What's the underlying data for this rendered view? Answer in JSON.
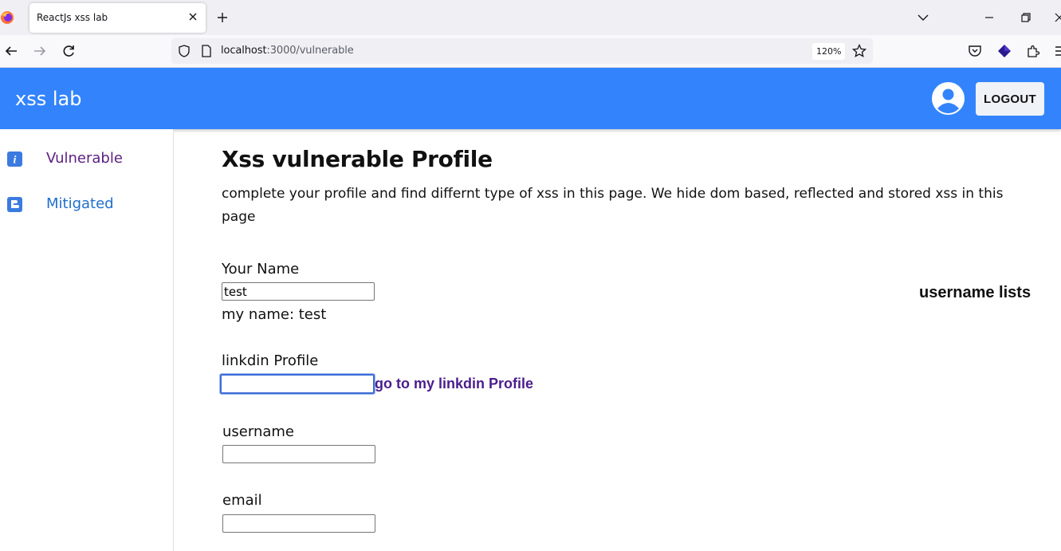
{
  "browser": {
    "tab_title": "ReactJs xss lab",
    "url_host": "localhost",
    "url_rest": ":3000/vulnerable",
    "zoom": "120%"
  },
  "app": {
    "title": "xss lab",
    "logout_label": "LOGOUT"
  },
  "sidebar": {
    "items": [
      {
        "label": "Vulnerable",
        "icon": "info-icon",
        "color": "#5b1e82"
      },
      {
        "label": "Mitigated",
        "icon": "blogger-icon",
        "color": "#1f6fcb"
      }
    ]
  },
  "main": {
    "title": "Xss vulnerable Profile",
    "description": "complete your profile and find differnt type of xss in this page. We hide dom based, reflected and stored xss in this page",
    "your_name_label": "Your Name",
    "your_name_value": "test",
    "my_name_text": "my name: test",
    "linkedin_label": "linkdin Profile",
    "linkedin_value": "",
    "linkedin_link": "go to my linkdin Profile",
    "username_label": "username",
    "username_value": "",
    "email_label": "email",
    "email_value": "",
    "username_lists_heading": "username lists"
  },
  "colors": {
    "appbar": "#3384fc",
    "link": "#4a1e8c"
  }
}
